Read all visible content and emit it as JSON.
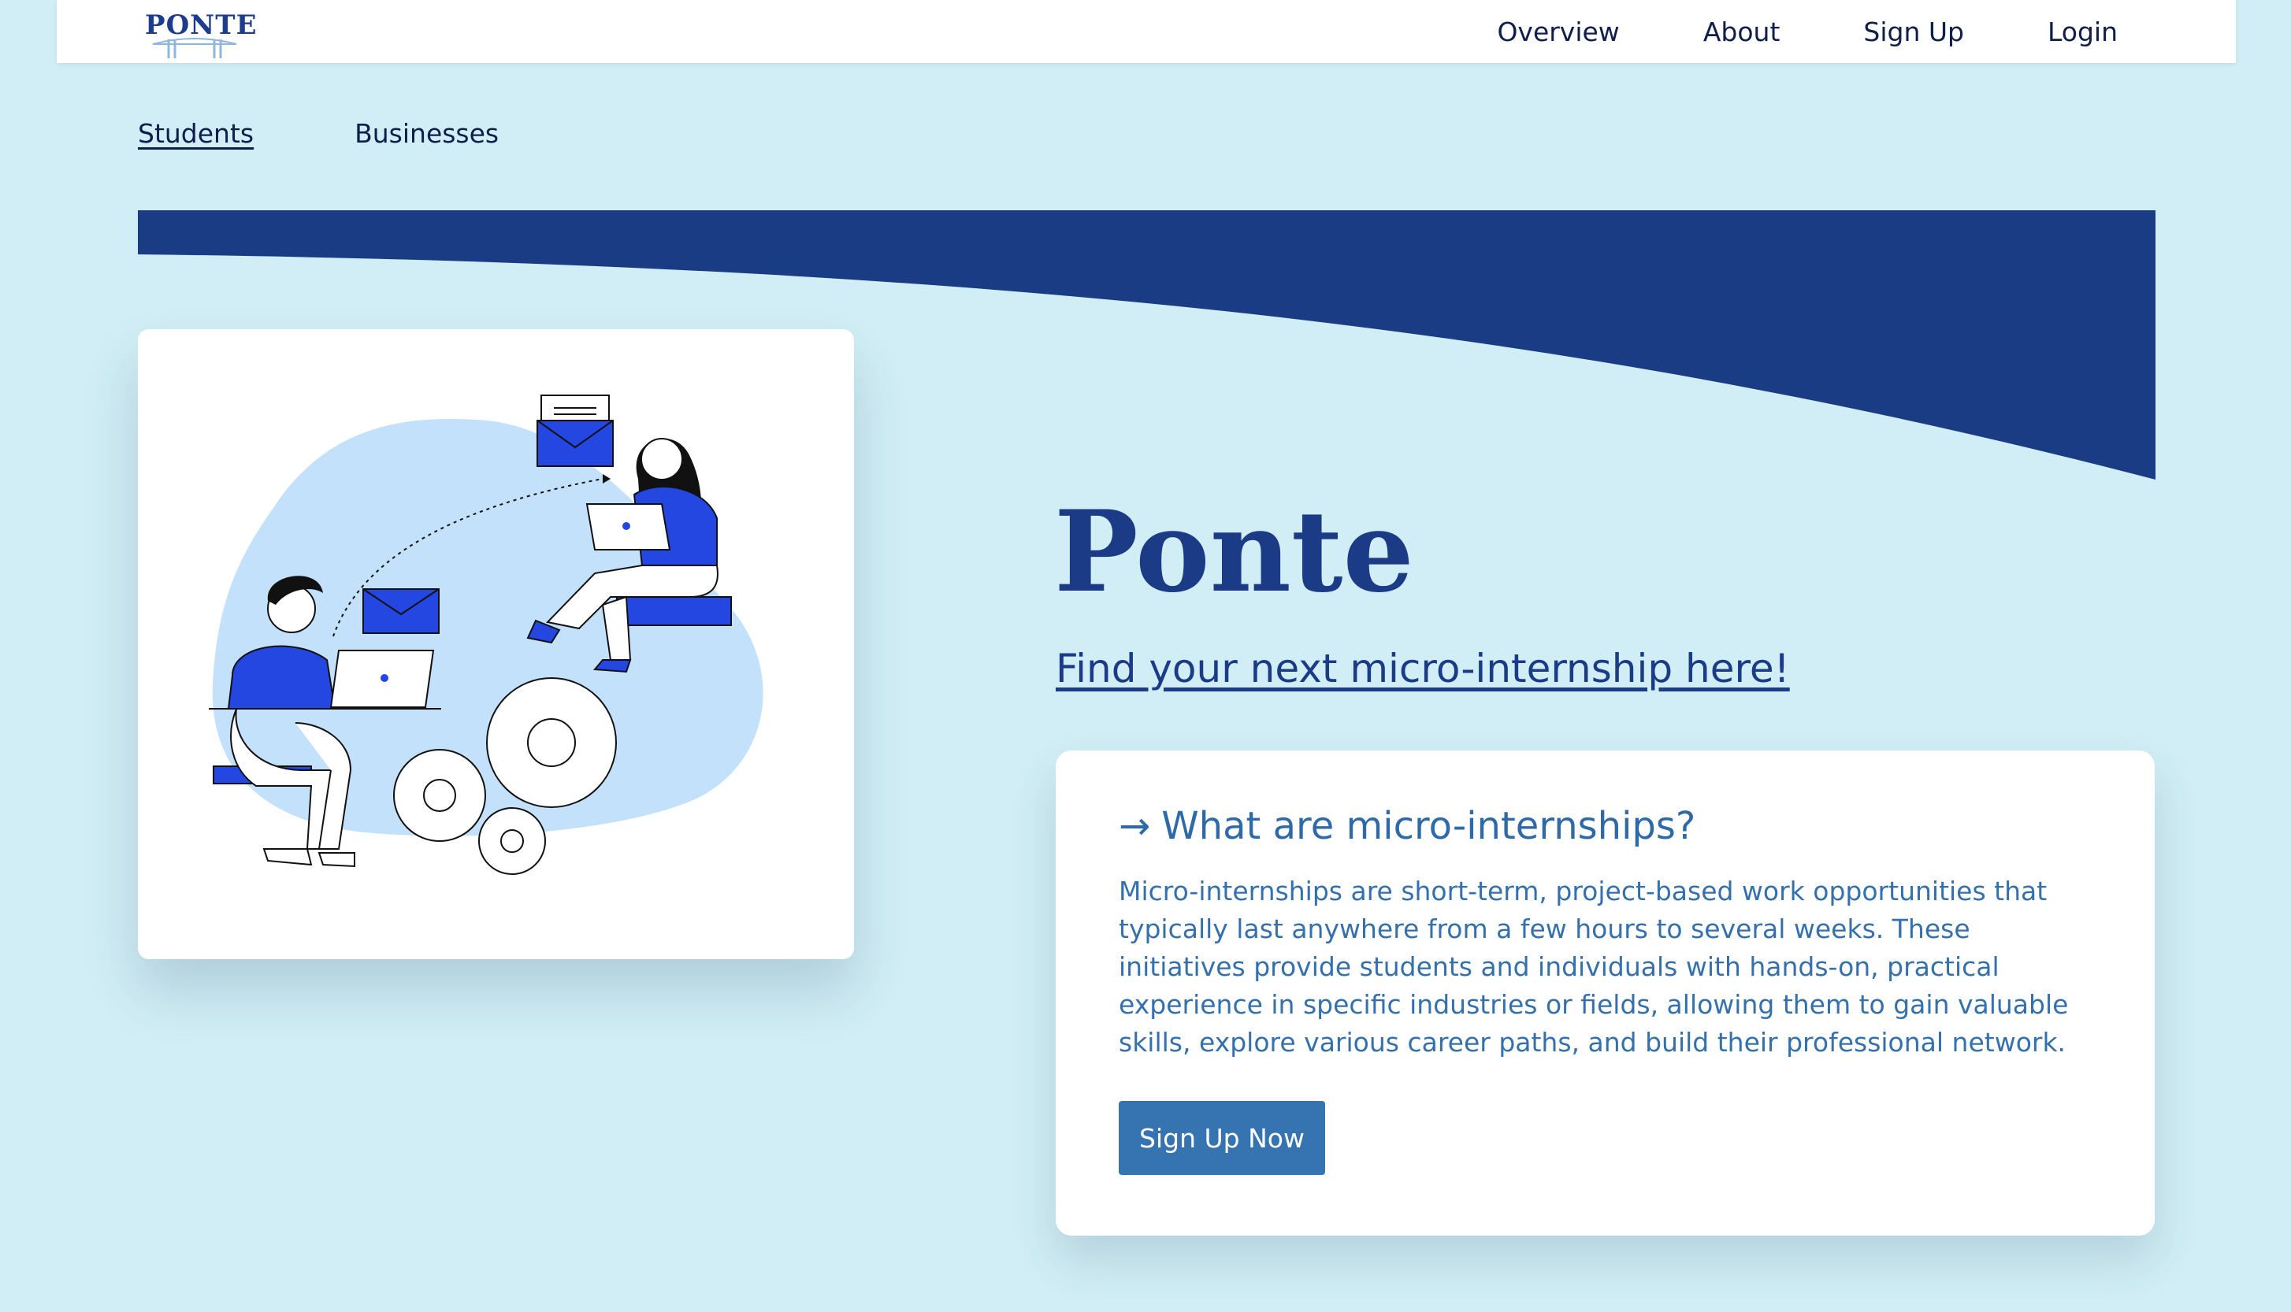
{
  "brand": {
    "logo_text": "PONTE"
  },
  "nav": {
    "items": [
      {
        "label": "Overview"
      },
      {
        "label": "About"
      },
      {
        "label": "Sign Up"
      },
      {
        "label": "Login"
      }
    ]
  },
  "tabs": {
    "items": [
      {
        "label": "Students",
        "active": true
      },
      {
        "label": "Businesses",
        "active": false
      }
    ]
  },
  "hero": {
    "title": "Ponte",
    "subtitle_link": "Find your next micro-internship here!"
  },
  "info": {
    "arrow": "→",
    "heading": "What are micro-internships?",
    "body": "Micro-internships are short-term, project-based work opportunities that typically last anywhere from a few hours to several weeks. These initiatives provide students and individuals with hands-on, practical experience in specific industries or fields, allowing them to gain valuable skills, explore various career paths, and build their professional network.",
    "button_label": "Sign Up Now"
  },
  "colors": {
    "background": "#d1eef6",
    "navy": "#1b3b87",
    "accent_blue": "#3574b0",
    "illustration_blue": "#2347e0"
  }
}
